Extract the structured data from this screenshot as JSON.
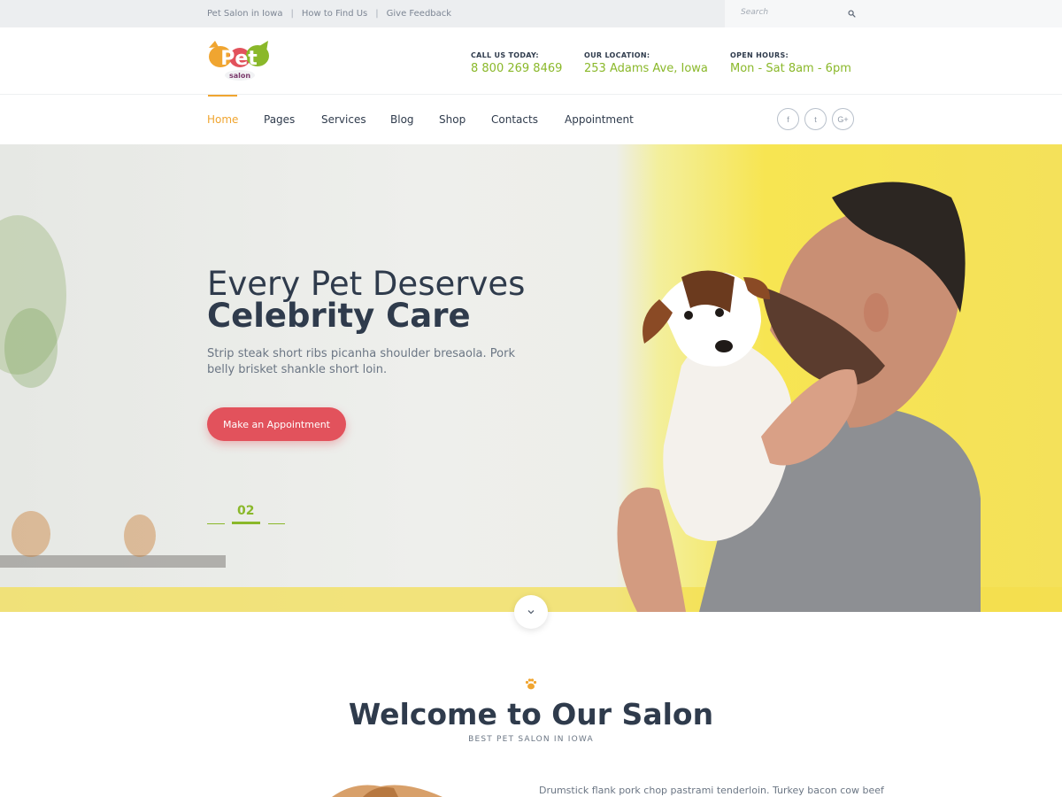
{
  "topbar": {
    "links": [
      "Pet Salon in Iowa",
      "How to Find Us",
      "Give Feedback"
    ],
    "separator": "|",
    "search_placeholder": "Search"
  },
  "header": {
    "logo_text": "Pet",
    "logo_sub": "salon",
    "call": {
      "label": "CALL US TODAY:",
      "value": "8 800 269 8469"
    },
    "location": {
      "label": "OUR LOCATION:",
      "value": "253 Adams Ave, Iowa"
    },
    "hours": {
      "label": "OPEN HOURS:",
      "value": "Mon - Sat 8am - 6pm"
    }
  },
  "nav": {
    "items": [
      "Home",
      "Pages",
      "Services",
      "Blog",
      "Shop",
      "Contacts",
      "Appointment"
    ],
    "active_index": 0,
    "social": [
      "f",
      "t",
      "G+"
    ]
  },
  "hero": {
    "title_line1": "Every Pet Deserves",
    "title_line2": "Celebrity Care",
    "description": "Strip steak short ribs picanha shoulder bresaola. Pork belly brisket shankle short loin.",
    "cta_label": "Make an Appointment",
    "slide_number": "02"
  },
  "welcome": {
    "title": "Welcome to Our Salon",
    "subtitle": "BEST PET SALON IN IOWA",
    "text": "Drumstick flank pork chop pastrami tenderloin. Turkey bacon cow beef"
  },
  "colors": {
    "accent_orange": "#f0a530",
    "accent_green": "#8ab82a",
    "cta_red": "#e2525c",
    "text_dark": "#2f3b4c"
  },
  "icons": {
    "search": "search-icon",
    "paw": "paw-icon",
    "scroll": "chevron-down-icon"
  }
}
